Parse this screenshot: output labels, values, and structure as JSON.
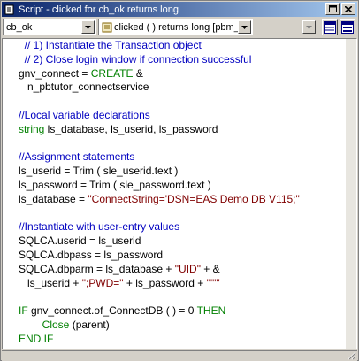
{
  "window": {
    "title": "Script - clicked for cb_ok returns long"
  },
  "toolbar": {
    "object_select": "cb_ok",
    "event_select": "clicked ( )  returns long [pbm_",
    "ancestor_select": ""
  },
  "code": {
    "lines": [
      [
        {
          "t": "  // 1) Instantiate the Transaction object",
          "c": "cmt"
        }
      ],
      [
        {
          "t": "  // 2) Close login window if connection successful",
          "c": "cmt"
        }
      ],
      [
        {
          "t": "gnv_connect = ",
          "c": ""
        },
        {
          "t": "CREATE",
          "c": "kw"
        },
        {
          "t": " &",
          "c": ""
        }
      ],
      [
        {
          "t": "   n_pbtutor_connectservice",
          "c": ""
        }
      ],
      [
        {
          "t": "",
          "c": ""
        }
      ],
      [
        {
          "t": "//Local variable declarations",
          "c": "cmt"
        }
      ],
      [
        {
          "t": "string",
          "c": "kw"
        },
        {
          "t": " ls_database, ls_userid, ls_password",
          "c": ""
        }
      ],
      [
        {
          "t": "",
          "c": ""
        }
      ],
      [
        {
          "t": "//Assignment statements",
          "c": "cmt"
        }
      ],
      [
        {
          "t": "ls_userid = Trim ( sle_userid.text )",
          "c": ""
        }
      ],
      [
        {
          "t": "ls_password = Trim ( sle_password.text )",
          "c": ""
        }
      ],
      [
        {
          "t": "ls_database = ",
          "c": ""
        },
        {
          "t": "\"ConnectString='DSN=EAS Demo DB V115;\"",
          "c": "str"
        }
      ],
      [
        {
          "t": "",
          "c": ""
        }
      ],
      [
        {
          "t": "//Instantiate with user-entry values",
          "c": "cmt"
        }
      ],
      [
        {
          "t": "SQLCA.userid = ls_userid",
          "c": ""
        }
      ],
      [
        {
          "t": "SQLCA.dbpass = ls_password",
          "c": ""
        }
      ],
      [
        {
          "t": "SQLCA.dbparm = ls_database + ",
          "c": ""
        },
        {
          "t": "\"UID\"",
          "c": "str"
        },
        {
          "t": " + &",
          "c": ""
        }
      ],
      [
        {
          "t": "   ls_userid + ",
          "c": ""
        },
        {
          "t": "\";PWD=\"",
          "c": "str"
        },
        {
          "t": " + ls_password + ",
          "c": ""
        },
        {
          "t": "\"'\"\"",
          "c": "str"
        }
      ],
      [
        {
          "t": "",
          "c": ""
        }
      ],
      [
        {
          "t": "IF",
          "c": "kw"
        },
        {
          "t": " gnv_connect.of_ConnectDB ( ) = 0 ",
          "c": ""
        },
        {
          "t": "THEN",
          "c": "kw"
        }
      ],
      [
        {
          "t": "        Close",
          "c": "kw"
        },
        {
          "t": " (parent)",
          "c": ""
        }
      ],
      [
        {
          "t": "END IF",
          "c": "kw"
        }
      ]
    ]
  },
  "colors": {
    "comment": "#0000c0",
    "keyword": "#008000",
    "string": "#800000",
    "titlebar": "#0a246a"
  }
}
